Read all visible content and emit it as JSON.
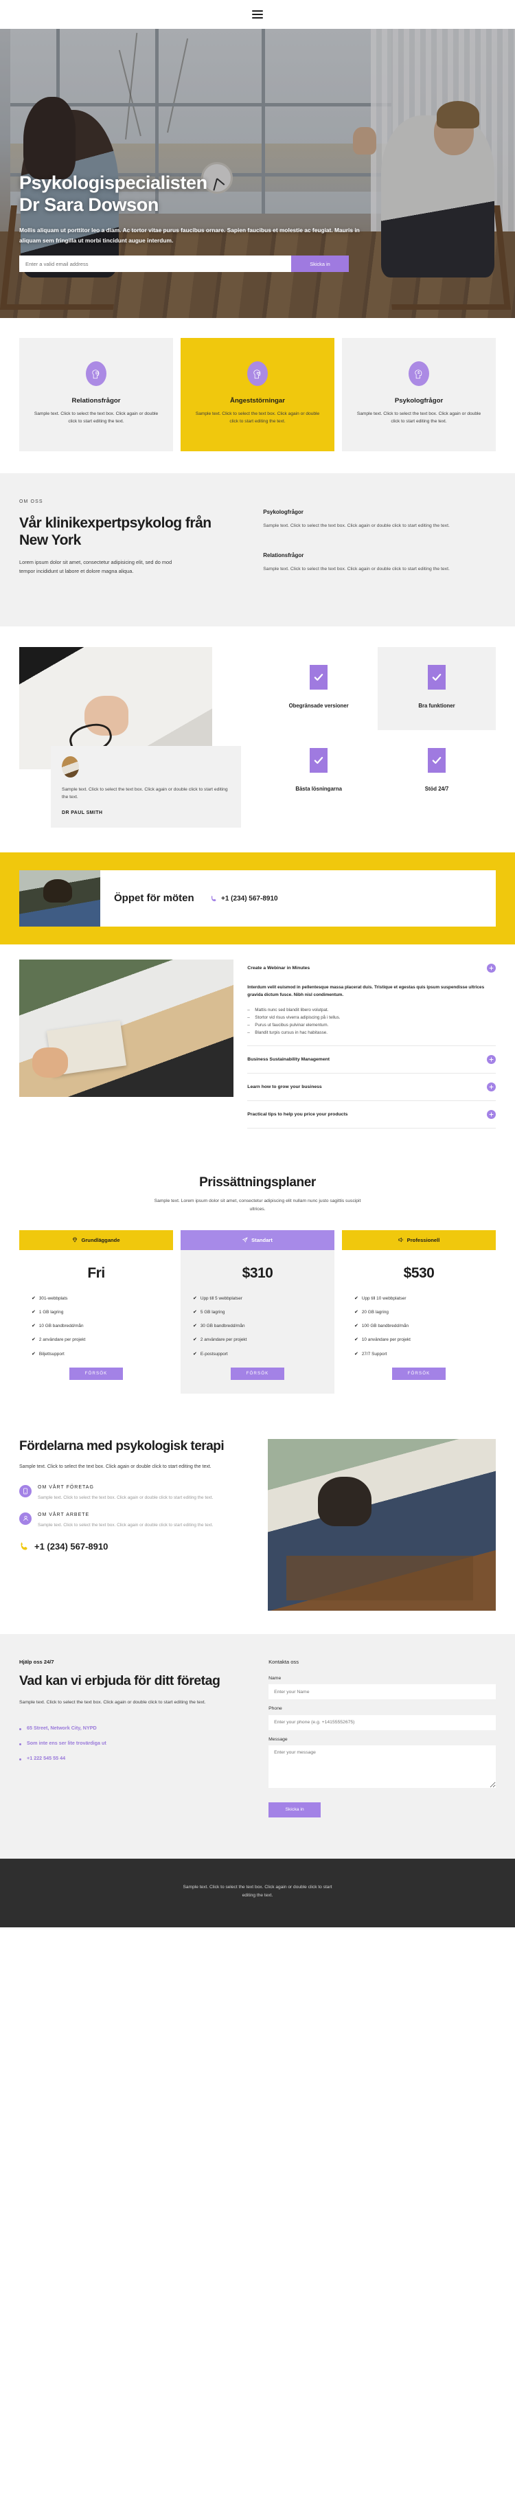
{
  "nav": {
    "menu_label": "menu"
  },
  "hero": {
    "title_line1": "Psykologispecialisten",
    "title_line2": "Dr Sara Dowson",
    "subtitle": "Mollis aliquam ut porttitor leo a diam. Ac tortor vitae purus faucibus ornare. Sapien faucibus et molestie ac feugiat. Mauris in aliquam sem fringilla ut morbi tincidunt augue interdum.",
    "email_placeholder": "Enter a valid email address",
    "submit_label": "Skicka in"
  },
  "services": {
    "cards": [
      {
        "icon": "head-puzzle-icon",
        "title": "Relationsfrågor",
        "desc": "Sample text. Click to select the text box. Click again or double click to start editing the text.",
        "highlight": false
      },
      {
        "icon": "head-heart-icon",
        "title": "Ångeststörningar",
        "desc": "Sample text. Click to select the text box. Click again or double click to start editing the text.",
        "highlight": true
      },
      {
        "icon": "head-brain-icon",
        "title": "Psykologfrågor",
        "desc": "Sample text. Click to select the text box. Click again or double click to start editing the text.",
        "highlight": false
      }
    ]
  },
  "about": {
    "eyebrow": "OM OSS",
    "title": "Vår klinikexpertpsykolog från New York",
    "text": "Lorem ipsum dolor sit amet, consectetur adipisicing elit, sed do mod tempor incididunt ut labore et dolore magna aliqua.",
    "items": [
      {
        "title": "Psykologfrågor",
        "text": "Sample text. Click to select the text box. Click again or double click to start editing the text."
      },
      {
        "title": "Relationsfrågor",
        "text": "Sample text. Click to select the text box. Click again or double click to start editing the text."
      }
    ]
  },
  "features": {
    "testimonial": {
      "text": "Sample text. Click to select the text box. Click again or double click to start editing the text.",
      "author": "DR PAUL SMITH"
    },
    "cells": [
      {
        "label": "Obegränsade versioner",
        "shaded": false
      },
      {
        "label": "Bra funktioner",
        "shaded": true
      },
      {
        "label": "Bästa lösningarna",
        "shaded": false
      },
      {
        "label": "Stöd 24/7",
        "shaded": false
      }
    ]
  },
  "cta": {
    "title": "Öppet för möten",
    "phone": "+1 (234) 567-8910"
  },
  "accordion": {
    "items": [
      {
        "question": "Create a Webinar in Minutes",
        "lead": "Interdum velit euismod in pellentesque massa placerat duis. Tristique et egestas quis ipsum suspendisse ultrices gravida dictum fusce. Nibh nisl condimentum.",
        "bullets": [
          "Mattis nunc sed blandit libero volutpat.",
          "Stortor vid risus viverra adipiscing på i tellus.",
          "Purus ut faucibus pulvinar elementum.",
          "Blandit turpis cursus in hac habitasse."
        ]
      },
      {
        "question": "Business Sustainability Management",
        "lead": "",
        "bullets": []
      },
      {
        "question": "Learn how to grow your business",
        "lead": "",
        "bullets": []
      },
      {
        "question": "Practical tips to help you price your products",
        "lead": "",
        "bullets": []
      }
    ],
    "toggle_label": "+"
  },
  "pricing": {
    "title": "Prissättningsplaner",
    "subtitle": "Sample text. Lorem ipsum dolor sit amet, consectetur adipiscing elit nullam nunc justo sagittis suscipit ultrices.",
    "plans": [
      {
        "badge": "Grundläggande",
        "badge_icon": "diamond-icon",
        "badge_color": "yellow",
        "price": "Fri",
        "featured": false,
        "features": [
          "301-webbplats",
          "1 GB lagring",
          "10 GB bandbredd/mån",
          "2 användare per projekt",
          "Biljettsupport"
        ],
        "button": "FÖRSÖK"
      },
      {
        "badge": "Standart",
        "badge_icon": "paper-plane-icon",
        "badge_color": "purple",
        "price": "$310",
        "featured": true,
        "features": [
          "Upp till 5 webbplatser",
          "5 GB lagring",
          "30 GB bandbredd/mån",
          "2 användare per projekt",
          "E-postsupport"
        ],
        "button": "FÖRSÖK"
      },
      {
        "badge": "Professionell",
        "badge_icon": "megaphone-icon",
        "badge_color": "yellow",
        "price": "$530",
        "featured": false,
        "features": [
          "Upp till 10 webbplatser",
          "20 GB lagring",
          "100 GB bandbredd/mån",
          "10 användare per projekt",
          "27/7 Support"
        ],
        "button": "FÖRSÖK"
      }
    ]
  },
  "benefits": {
    "title": "Fördelarna med psykologisk terapi",
    "text": "Sample text. Click to select the text box. Click again or double click to start editing the text.",
    "items": [
      {
        "icon": "mobile-icon",
        "title": "OM VÅRT FÖRETAG",
        "text": "Sample text. Click to select the text box. Click again or double click to start editing the text."
      },
      {
        "icon": "user-icon",
        "title": "OM VÅRT ARBETE",
        "text": "Sample text. Click to select the text box. Click again or double click to start editing the text."
      }
    ],
    "phone": "+1 (234) 567-8910"
  },
  "contact": {
    "eyebrow": "Hjälp oss 24/7",
    "title": "Vad kan vi erbjuda för ditt företag",
    "text": "Sample text. Click to select the text box. Click again or double click to start editing the text.",
    "links": [
      "65 Street, Network City, NYPD",
      "Som inte ens ser lite trovärdiga ut",
      "+1 222 545 55 44"
    ],
    "form_title": "Kontakta oss",
    "fields": [
      {
        "label": "Name",
        "placeholder": "Enter your Name",
        "type": "input"
      },
      {
        "label": "Phone",
        "placeholder": "Enter your phone (e.g. +14155552675)",
        "type": "input"
      },
      {
        "label": "Message",
        "placeholder": "Enter your message",
        "type": "textarea"
      }
    ],
    "submit_label": "Skicka in"
  },
  "footer": {
    "text": "Sample text. Click to select the text box. Click again or double click to start editing the text."
  },
  "colors": {
    "yellow": "#f0c80d",
    "purple": "#a382e6",
    "dark": "#2f2f2f",
    "light_gray": "#f1f1f1"
  }
}
